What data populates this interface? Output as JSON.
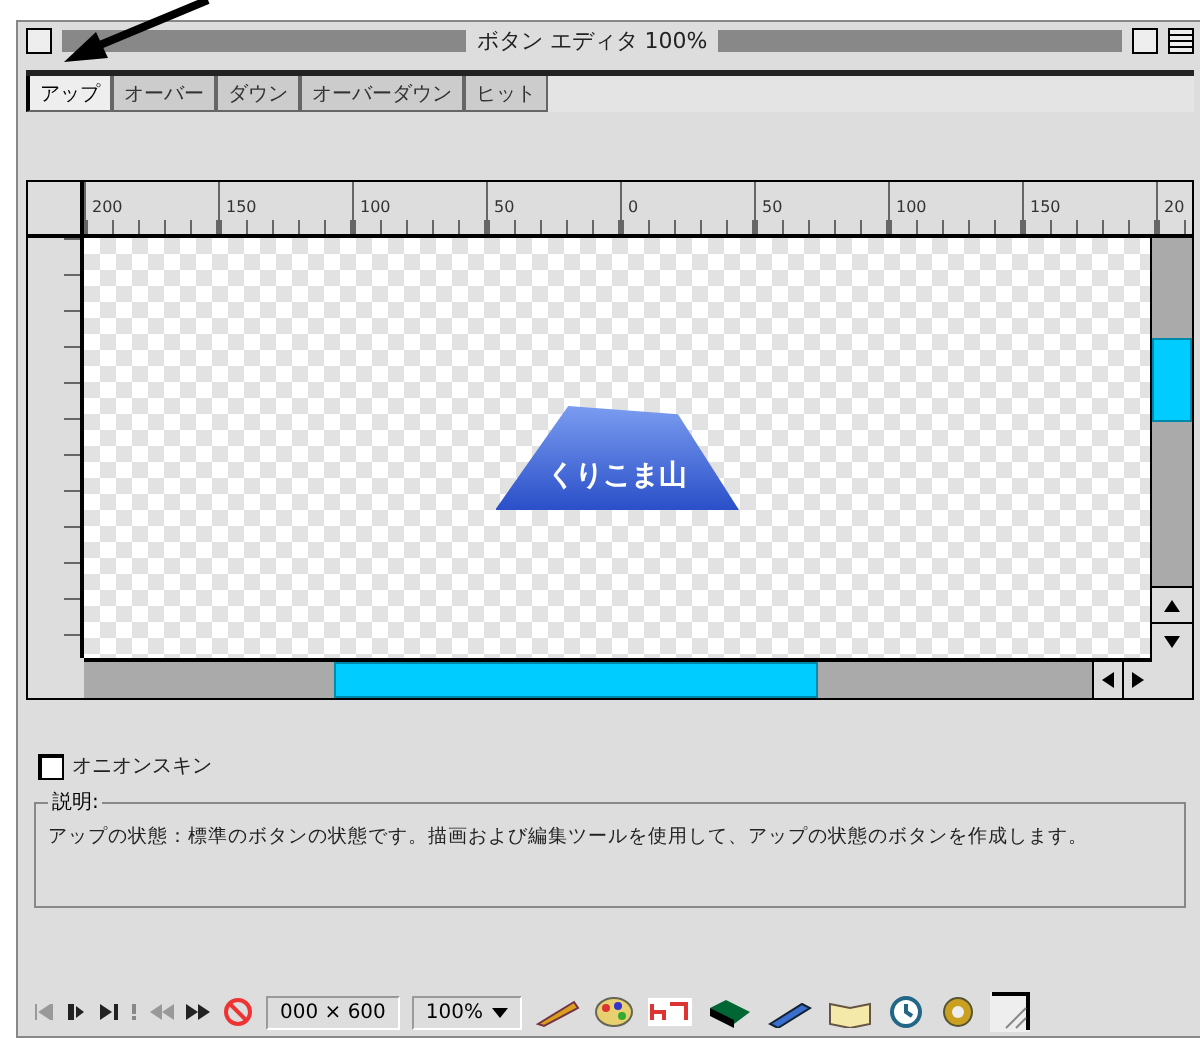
{
  "window": {
    "title": "ボタン エディタ 100%"
  },
  "tabs": [
    {
      "label": "アップ",
      "selected": true
    },
    {
      "label": "オーバー",
      "selected": false
    },
    {
      "label": "ダウン",
      "selected": false
    },
    {
      "label": "オーバーダウン",
      "selected": false
    },
    {
      "label": "ヒット",
      "selected": false
    }
  ],
  "ruler": {
    "labels": [
      "200",
      "150",
      "100",
      "50",
      "0",
      "50",
      "100",
      "150",
      "20"
    ]
  },
  "canvas": {
    "button_text": "くりこま山"
  },
  "onion_skin": {
    "label": "オニオンスキン",
    "checked": false
  },
  "description": {
    "legend": "説明:",
    "text": "アップの状態：標準のボタンの状態です。描画および編集ツールを使用して、アップの状態のボタンを作成します。"
  },
  "status_bar": {
    "size": "000 × 600",
    "zoom": "100%"
  }
}
